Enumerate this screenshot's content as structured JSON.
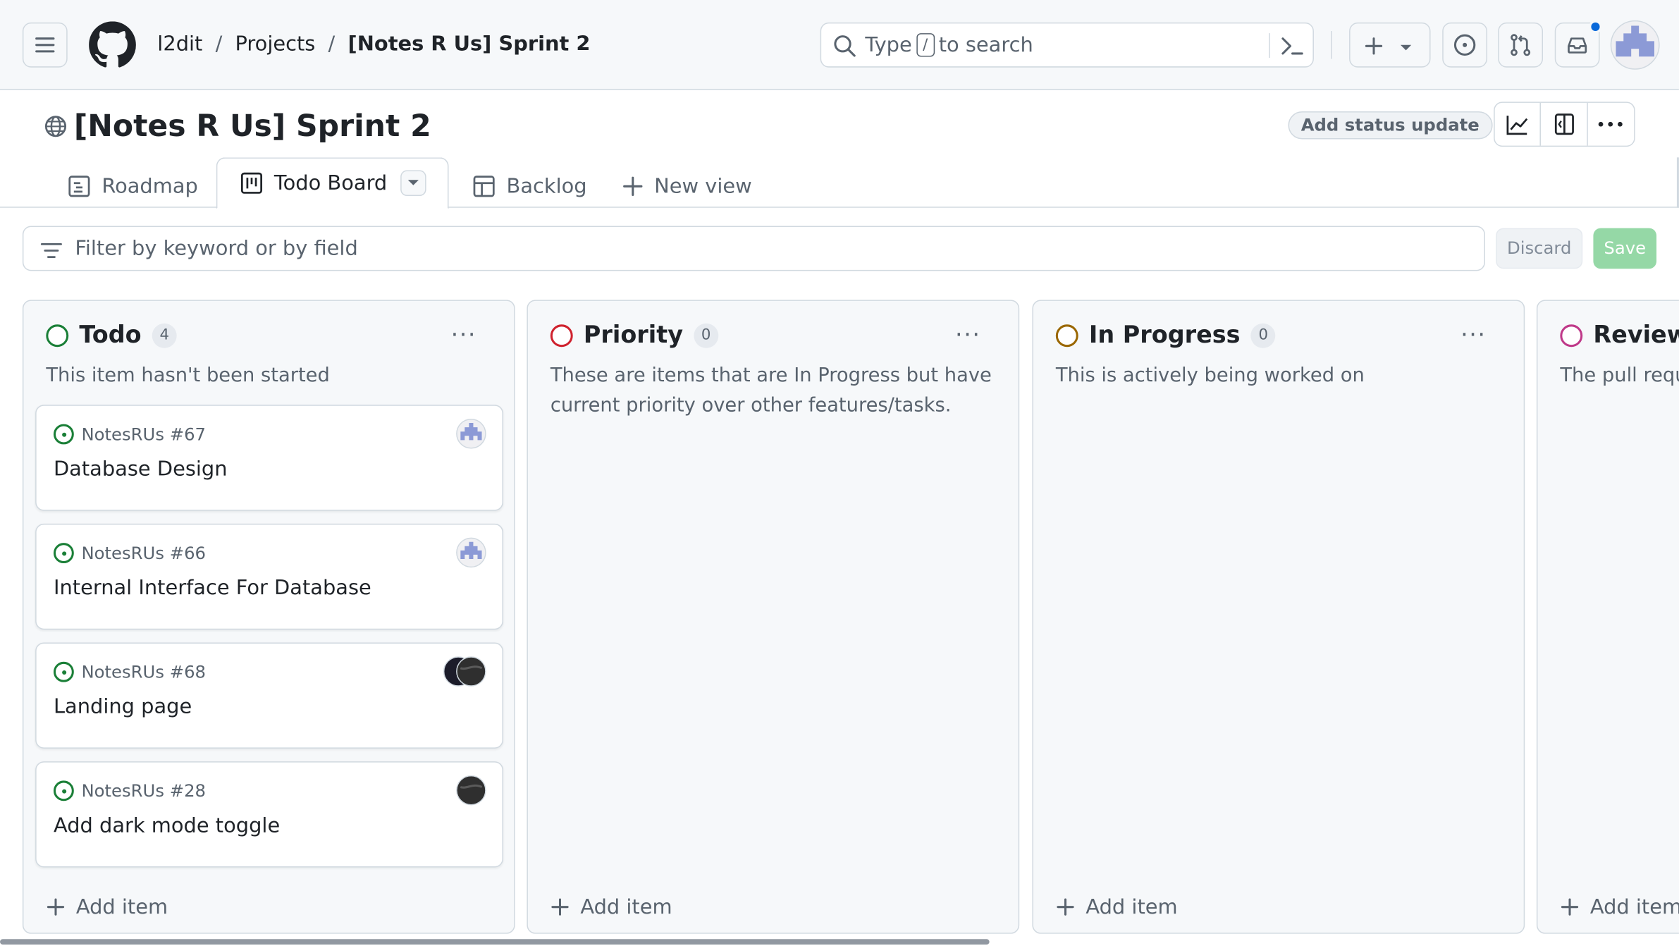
{
  "header": {
    "breadcrumbs": [
      "l2dit",
      "Projects",
      "[Notes R Us] Sprint 2"
    ],
    "separator": "/",
    "search_placeholder_pre": "Type",
    "search_key": "/",
    "search_placeholder_post": "to search",
    "icons": [
      "hamburger-icon",
      "github-logo",
      "search-icon",
      "command-palette-icon",
      "plus-icon",
      "chevron-down-icon",
      "issues-icon",
      "pull-requests-icon",
      "inbox-icon",
      "avatar"
    ],
    "notification_color": "#0969da"
  },
  "project": {
    "title": "[Notes R Us] Sprint 2",
    "status_update_label": "Add status update",
    "toolbar_icons": [
      "insights-icon",
      "side-panel-icon",
      "kebab-icon"
    ]
  },
  "tabs": [
    {
      "label": "Roadmap",
      "icon": "roadmap-icon"
    },
    {
      "label": "Todo Board",
      "icon": "board-icon",
      "active": true
    },
    {
      "label": "Backlog",
      "icon": "table-icon"
    },
    {
      "label": "New view",
      "icon": "plus-icon"
    }
  ],
  "filter": {
    "placeholder": "Filter by keyword or by field",
    "discard_label": "Discard",
    "save_label": "Save"
  },
  "columns": [
    {
      "name": "Todo",
      "count": "4",
      "color": "#1a7f37",
      "description": "This item hasn't been started",
      "add_label": "Add item",
      "cards": [
        {
          "ref": "NotesRUs #67",
          "title": "Database Design"
        },
        {
          "ref": "NotesRUs #66",
          "title": "Internal Interface For Database"
        },
        {
          "ref": "NotesRUs #68",
          "title": "Landing page"
        },
        {
          "ref": "NotesRUs #28",
          "title": "Add dark mode toggle"
        }
      ]
    },
    {
      "name": "Priority",
      "count": "0",
      "color": "#cf222e",
      "description": "These are items that are In Progress but have current priority over other features/tasks.",
      "add_label": "Add item",
      "cards": []
    },
    {
      "name": "In Progress",
      "count": "0",
      "color": "#9a6700",
      "description": "This is actively being worked on",
      "add_label": "Add item",
      "cards": []
    },
    {
      "name": "Reviewe",
      "count": "",
      "color": "#bf3989",
      "description": "The pull requ",
      "add_label": "Add item",
      "cards": []
    }
  ]
}
